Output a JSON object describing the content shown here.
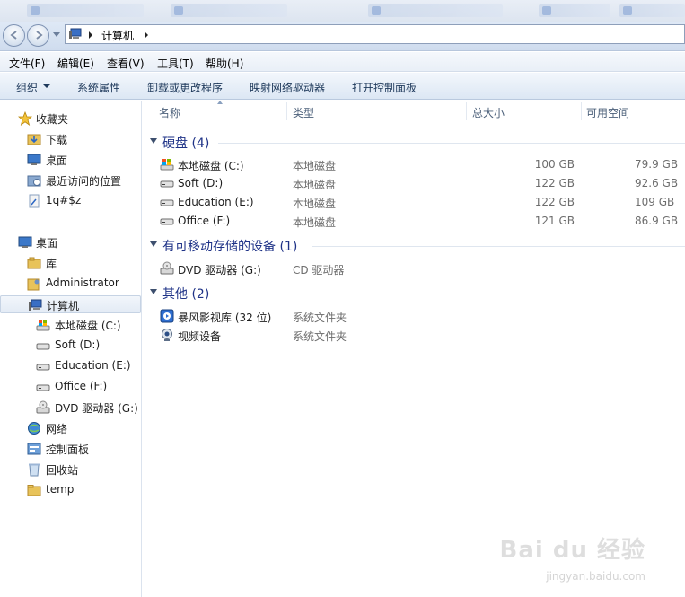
{
  "window": {
    "address": {
      "path_item": "计算机"
    }
  },
  "menubar": {
    "items": [
      "文件(F)",
      "编辑(E)",
      "查看(V)",
      "工具(T)",
      "帮助(H)"
    ]
  },
  "commandbar": {
    "organize": "组织",
    "items": [
      "系统属性",
      "卸载或更改程序",
      "映射网络驱动器",
      "打开控制面板"
    ]
  },
  "navpane": {
    "favorites": {
      "label": "收藏夹",
      "icon": "star-icon"
    },
    "favorites_items": [
      {
        "label": "下载",
        "icon": "downloads-folder-icon"
      },
      {
        "label": "桌面",
        "icon": "desktop-icon"
      },
      {
        "label": "最近访问的位置",
        "icon": "recent-places-icon"
      },
      {
        "label": "1q#$z",
        "icon": "link-icon"
      }
    ],
    "desktop": {
      "label": "桌面",
      "icon": "desktop-icon"
    },
    "desktop_items": [
      {
        "label": "库",
        "icon": "library-icon"
      },
      {
        "label": "Administrator",
        "icon": "user-folder-icon"
      },
      {
        "label": "计算机",
        "icon": "computer-icon"
      }
    ],
    "computer_items": [
      {
        "label": "本地磁盘 (C:)",
        "icon": "system-drive-icon"
      },
      {
        "label": "Soft (D:)",
        "icon": "hard-drive-icon"
      },
      {
        "label": "Education (E:)",
        "icon": "hard-drive-icon"
      },
      {
        "label": "Office (F:)",
        "icon": "hard-drive-icon"
      },
      {
        "label": "DVD 驱动器 (G:)",
        "icon": "dvd-drive-icon"
      }
    ],
    "other_items": [
      {
        "label": "网络",
        "icon": "network-icon"
      },
      {
        "label": "控制面板",
        "icon": "control-panel-icon"
      },
      {
        "label": "回收站",
        "icon": "recycle-bin-icon"
      },
      {
        "label": "temp",
        "icon": "folder-icon"
      }
    ]
  },
  "columns": {
    "name": "名称",
    "type": "类型",
    "total": "总大小",
    "free": "可用空间"
  },
  "groups": [
    {
      "label": "硬盘 (4)",
      "rows": [
        {
          "name": "本地磁盘 (C:)",
          "type": "本地磁盘",
          "total": "100 GB",
          "free": "79.9 GB",
          "icon": "system-drive-icon"
        },
        {
          "name": "Soft (D:)",
          "type": "本地磁盘",
          "total": "122 GB",
          "free": "92.6 GB",
          "icon": "hard-drive-icon"
        },
        {
          "name": "Education (E:)",
          "type": "本地磁盘",
          "total": "122 GB",
          "free": "109 GB",
          "icon": "hard-drive-icon"
        },
        {
          "name": "Office (F:)",
          "type": "本地磁盘",
          "total": "121 GB",
          "free": "86.9 GB",
          "icon": "hard-drive-icon"
        }
      ]
    },
    {
      "label": "有可移动存储的设备 (1)",
      "rows": [
        {
          "name": "DVD 驱动器 (G:)",
          "type": "CD 驱动器",
          "total": "",
          "free": "",
          "icon": "dvd-drive-icon"
        }
      ]
    },
    {
      "label": "其他 (2)",
      "rows": [
        {
          "name": "暴风影视库 (32 位)",
          "type": "系统文件夹",
          "total": "",
          "free": "",
          "icon": "media-library-icon"
        },
        {
          "name": "视频设备",
          "type": "系统文件夹",
          "total": "",
          "free": "",
          "icon": "webcam-icon"
        }
      ]
    }
  ],
  "watermark": {
    "brand": "Bai du 经验",
    "url": "jingyan.baidu.com"
  },
  "colors": {
    "group_header": "#1e3287",
    "cmd_text": "#1e395b",
    "selected_bg": "#e3ebf5"
  }
}
